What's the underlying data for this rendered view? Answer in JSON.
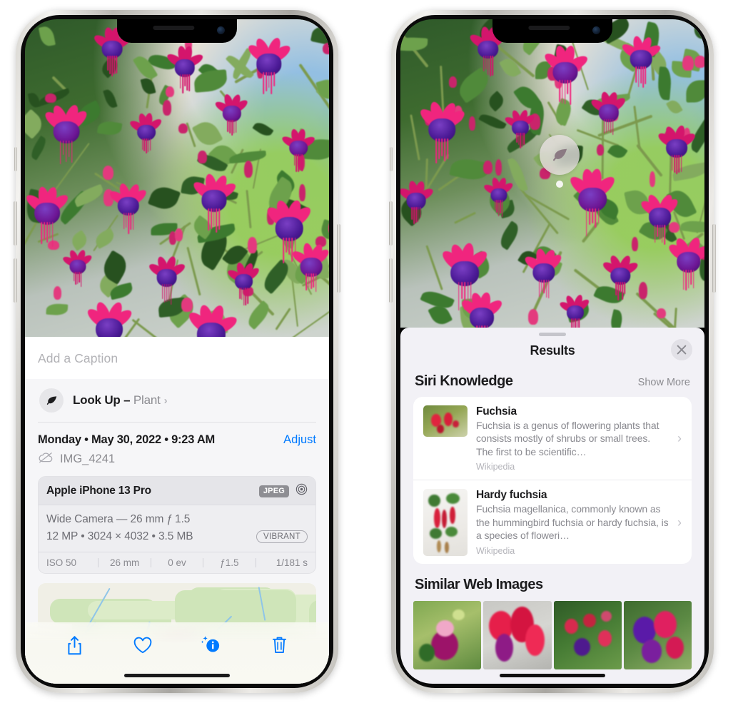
{
  "left_phone": {
    "caption_field": {
      "placeholder": "Add a Caption",
      "value": ""
    },
    "lookup_row": {
      "icon": "leaf-icon",
      "sparkle_icon": "sparkles-icon",
      "label": "Look Up – ",
      "subject": "Plant",
      "chevron": "›"
    },
    "date_row": {
      "date": "Monday • May 30, 2022 • 9:23 AM",
      "adjust_label": "Adjust"
    },
    "file_row": {
      "icon": "cloud-slash-icon",
      "filename": "IMG_4241"
    },
    "exif": {
      "model": "Apple iPhone 13 Pro",
      "format_badge": "JPEG",
      "lens_icon": "aperture-icon",
      "lens_line": "Wide Camera — 26 mm ƒ 1.5",
      "size_line": "12 MP • 3024 × 4032 • 3.5 MB",
      "style_badge": "VIBRANT",
      "stats": [
        "ISO 50",
        "26 mm",
        "0 ev",
        "ƒ1.5",
        "1/181 s"
      ]
    },
    "map": {
      "pin_label": "photo-pin"
    },
    "toolbar": [
      {
        "name": "share-button",
        "icon": "share-icon"
      },
      {
        "name": "favorite-button",
        "icon": "heart-icon"
      },
      {
        "name": "info-button",
        "icon": "info-sparkle-icon"
      },
      {
        "name": "delete-button",
        "icon": "trash-icon"
      }
    ]
  },
  "right_phone": {
    "visual_lookup_badge": {
      "icon": "leaf-icon"
    },
    "sheet": {
      "title": "Results",
      "close_label": "✕",
      "sections": [
        {
          "title": "Siri Knowledge",
          "action": "Show More",
          "items": [
            {
              "title": "Fuchsia",
              "description": "Fuchsia is a genus of flowering plants that consists mostly of shrubs or small trees. The first to be scientific…",
              "source": "Wikipedia",
              "chevron": "›"
            },
            {
              "title": "Hardy fuchsia",
              "description": "Fuchsia magellanica, commonly known as the hummingbird fuchsia or hardy fuchsia, is a species of floweri…",
              "source": "Wikipedia",
              "chevron": "›"
            }
          ]
        },
        {
          "title": "Similar Web Images",
          "action": "",
          "thumbnails": [
            {
              "name": "web-image-1"
            },
            {
              "name": "web-image-2"
            },
            {
              "name": "web-image-3"
            },
            {
              "name": "web-image-4"
            }
          ]
        }
      ]
    }
  },
  "colors": {
    "accent_blue": "#007aff",
    "sheet_bg": "#f2f1f6",
    "card_bg": "#ffffff",
    "secondary_text": "#8a8a90",
    "primary_text": "#1c1c1e"
  }
}
